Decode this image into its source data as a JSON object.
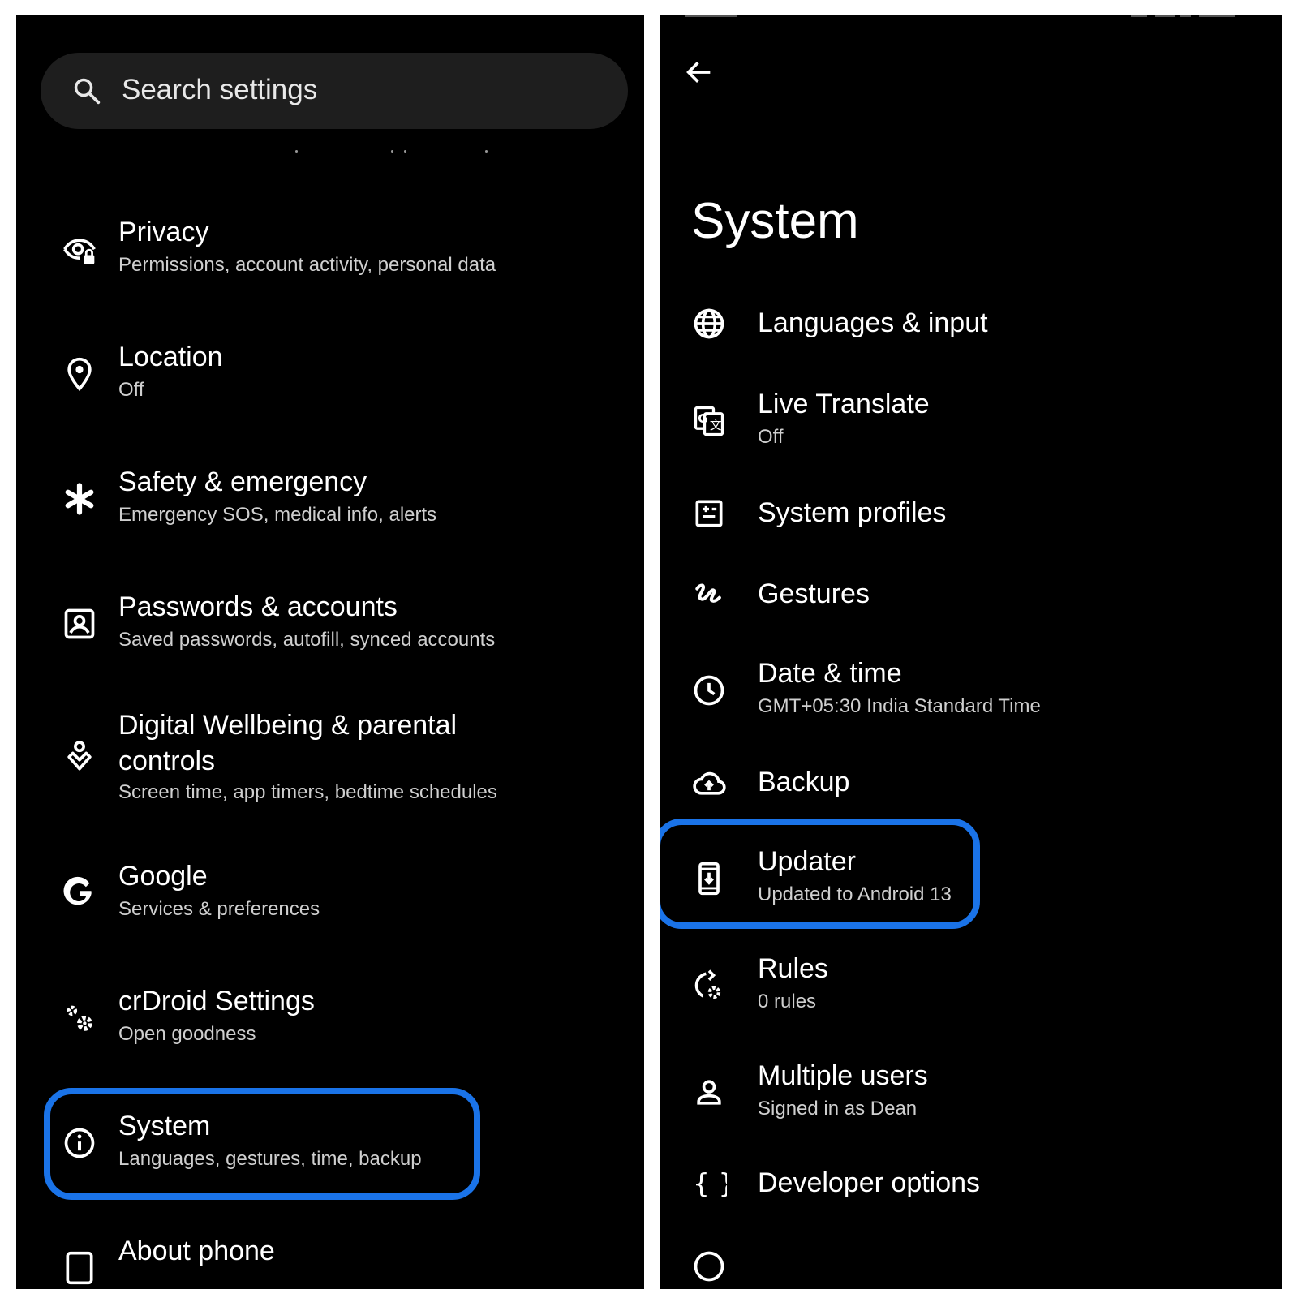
{
  "left": {
    "search": {
      "placeholder": "Search settings"
    },
    "items": [
      {
        "title": "Privacy",
        "subtitle": "Permissions, account activity, personal data",
        "icon": "eye-lock-icon"
      },
      {
        "title": "Location",
        "subtitle": "Off",
        "icon": "location-pin-icon"
      },
      {
        "title": "Safety & emergency",
        "subtitle": "Emergency SOS, medical info, alerts",
        "icon": "asterisk-icon"
      },
      {
        "title": "Passwords & accounts",
        "subtitle": "Saved passwords, autofill, synced accounts",
        "icon": "account-box-icon"
      },
      {
        "title_line1": "Digital Wellbeing & parental",
        "title_line2": "controls",
        "subtitle": "Screen time, app timers, bedtime schedules",
        "icon": "wellbeing-icon"
      },
      {
        "title": "Google",
        "subtitle": "Services & preferences",
        "icon": "google-g-icon"
      },
      {
        "title": "crDroid Settings",
        "subtitle": "Open goodness",
        "icon": "gears-icon"
      },
      {
        "title": "System",
        "subtitle": "Languages, gestures, time, backup",
        "icon": "info-icon"
      },
      {
        "title": "About phone",
        "icon": "phone-icon"
      }
    ]
  },
  "right": {
    "page_title": "System",
    "items": [
      {
        "title": "Languages & input",
        "icon": "globe-icon"
      },
      {
        "title": "Live Translate",
        "subtitle": "Off",
        "icon": "translate-icon"
      },
      {
        "title": "System profiles",
        "icon": "profiles-icon"
      },
      {
        "title": "Gestures",
        "icon": "gesture-icon"
      },
      {
        "title": "Date & time",
        "subtitle": "GMT+05:30 India Standard Time",
        "icon": "clock-icon"
      },
      {
        "title": "Backup",
        "icon": "cloud-upload-icon"
      },
      {
        "title": "Updater",
        "subtitle": "Updated to Android 13",
        "icon": "system-update-icon"
      },
      {
        "title": "Rules",
        "subtitle": "0 rules",
        "icon": "rules-icon"
      },
      {
        "title": "Multiple users",
        "subtitle": "Signed in as Dean",
        "icon": "person-icon"
      },
      {
        "title": "Developer options",
        "icon": "braces-icon"
      }
    ]
  },
  "colors": {
    "highlight": "#1a73e8",
    "background": "#000000"
  }
}
